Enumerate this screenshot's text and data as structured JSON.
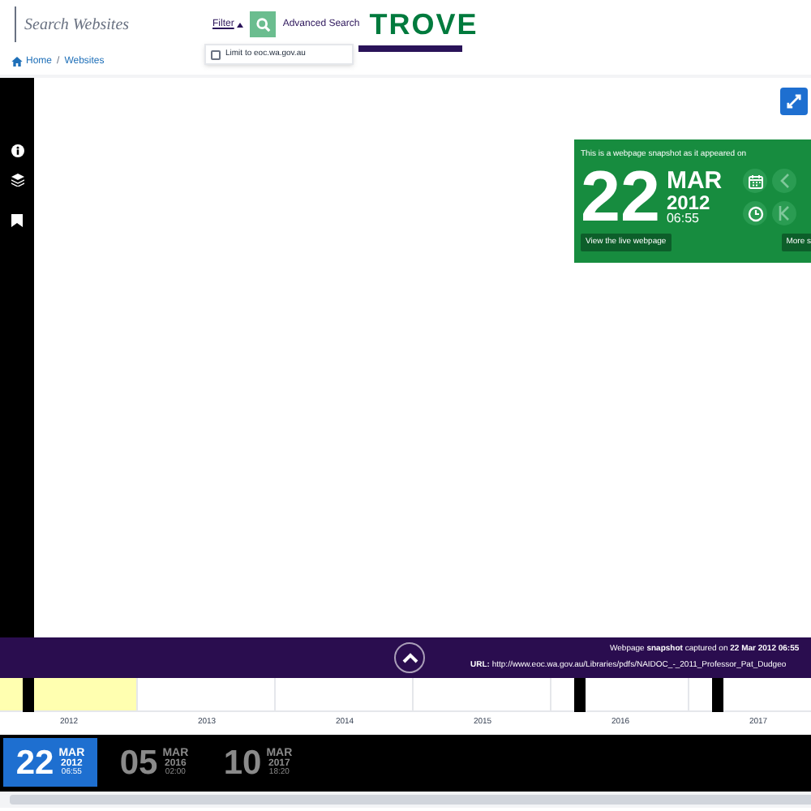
{
  "header": {
    "search": {
      "placeholder": "Search Websites"
    },
    "filter": "Filter",
    "advanced_search": "Advanced Search",
    "logo": "TROVE",
    "filter_menu": {
      "label": "Limit to eoc.wa.gov.au",
      "checked": false
    }
  },
  "breadcrumb": [
    "Home",
    "Websites"
  ],
  "breadcrumb_separator": "/",
  "snapshot_card": {
    "intro": "This is a webpage snapshot as it appeared on",
    "day": "22",
    "month": "MAR",
    "year": "2012",
    "time": "06:55",
    "live_button": "View the live webpage",
    "more_button": "More s"
  },
  "capture_bar": {
    "captured_prefix": "Webpage ",
    "captured_bold": "snapshot",
    "captured_mid": " captured on ",
    "captured_date": "22 Mar 2012 06:55",
    "url_label": "URL:",
    "url": "http://www.eoc.wa.gov.au/Libraries/pdfs/NAIDOC_-_2011_Professor_Pat_Dudgeo"
  },
  "timeline": [
    {
      "year": "2012",
      "selected": true,
      "has_snapshot": true
    },
    {
      "year": "2013",
      "selected": false,
      "has_snapshot": false
    },
    {
      "year": "2014",
      "selected": false,
      "has_snapshot": false
    },
    {
      "year": "2015",
      "selected": false,
      "has_snapshot": false
    },
    {
      "year": "2016",
      "selected": false,
      "has_snapshot": true
    },
    {
      "year": "2017",
      "selected": false,
      "has_snapshot": true
    }
  ],
  "snapshots": [
    {
      "day": "22",
      "month": "MAR",
      "year": "2012",
      "time": "06:55",
      "selected": true
    },
    {
      "day": "05",
      "month": "MAR",
      "year": "2016",
      "time": "02:00",
      "selected": false
    },
    {
      "day": "10",
      "month": "MAR",
      "year": "2017",
      "time": "18:20",
      "selected": false
    }
  ]
}
